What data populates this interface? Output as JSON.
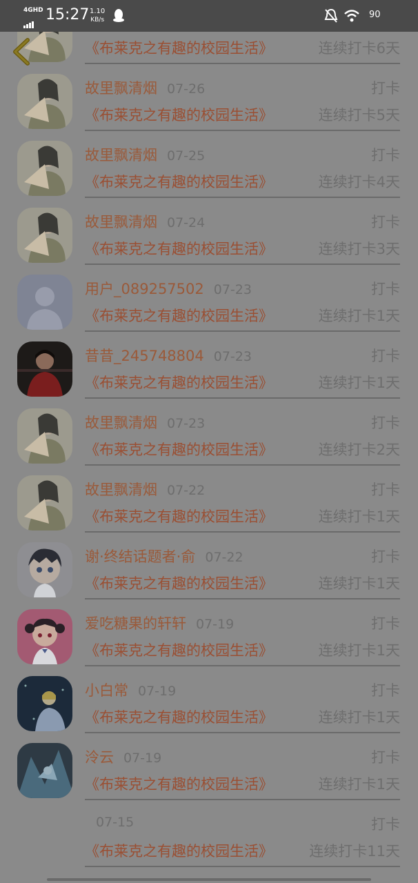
{
  "status_bar": {
    "network": "4GHD",
    "time": "15:27",
    "speed_value": "1.10",
    "speed_unit": "KB/s",
    "battery": "90"
  },
  "entries": [
    {
      "name": "",
      "date": "",
      "action": "",
      "book": "《布莱克之有趣的校园生活》",
      "streak": "连续打卡6天",
      "avatar": "girl-fan"
    },
    {
      "name": "故里飘清烟",
      "date": "07-26",
      "action": "打卡",
      "book": "《布莱克之有趣的校园生活》",
      "streak": "连续打卡5天",
      "avatar": "girl-fan"
    },
    {
      "name": "故里飘清烟",
      "date": "07-25",
      "action": "打卡",
      "book": "《布莱克之有趣的校园生活》",
      "streak": "连续打卡4天",
      "avatar": "girl-fan"
    },
    {
      "name": "故里飘清烟",
      "date": "07-24",
      "action": "打卡",
      "book": "《布莱克之有趣的校园生活》",
      "streak": "连续打卡3天",
      "avatar": "girl-fan"
    },
    {
      "name": "用户_089257502",
      "date": "07-23",
      "action": "打卡",
      "book": "《布莱克之有趣的校园生活》",
      "streak": "连续打卡1天",
      "avatar": "default"
    },
    {
      "name": "昔昔_245748804",
      "date": "07-23",
      "action": "打卡",
      "book": "《布莱克之有趣的校园生活》",
      "streak": "连续打卡1天",
      "avatar": "photo-girl"
    },
    {
      "name": "故里飘清烟",
      "date": "07-23",
      "action": "打卡",
      "book": "《布莱克之有趣的校园生活》",
      "streak": "连续打卡2天",
      "avatar": "girl-fan"
    },
    {
      "name": "故里飘清烟",
      "date": "07-22",
      "action": "打卡",
      "book": "《布莱克之有趣的校园生活》",
      "streak": "连续打卡1天",
      "avatar": "girl-fan"
    },
    {
      "name": "谢·终结话题者·俞",
      "date": "07-22",
      "action": "打卡",
      "book": "《布莱克之有趣的校园生活》",
      "streak": "连续打卡1天",
      "avatar": "anime-boy"
    },
    {
      "name": "爱吃糖果的轩轩",
      "date": "07-19",
      "action": "打卡",
      "book": "《布莱克之有趣的校园生活》",
      "streak": "连续打卡1天",
      "avatar": "anime-pink"
    },
    {
      "name": "小白常",
      "date": "07-19",
      "action": "打卡",
      "book": "《布莱克之有趣的校园生活》",
      "streak": "连续打卡1天",
      "avatar": "anime-night"
    },
    {
      "name": "泠云",
      "date": "07-19",
      "action": "打卡",
      "book": "《布莱克之有趣的校园生活》",
      "streak": "连续打卡1天",
      "avatar": "anime-blue"
    },
    {
      "name": "",
      "date": "07-15",
      "action": "打卡",
      "book": "《布莱克之有趣的校园生活》",
      "streak": "连续打卡11天",
      "avatar": "none"
    }
  ],
  "colors": {
    "overlay": "#8a8a8a",
    "status_bar": "#4a4a4a",
    "accent_text": "#9a5a3a",
    "back_arrow": "#6b5a10"
  }
}
